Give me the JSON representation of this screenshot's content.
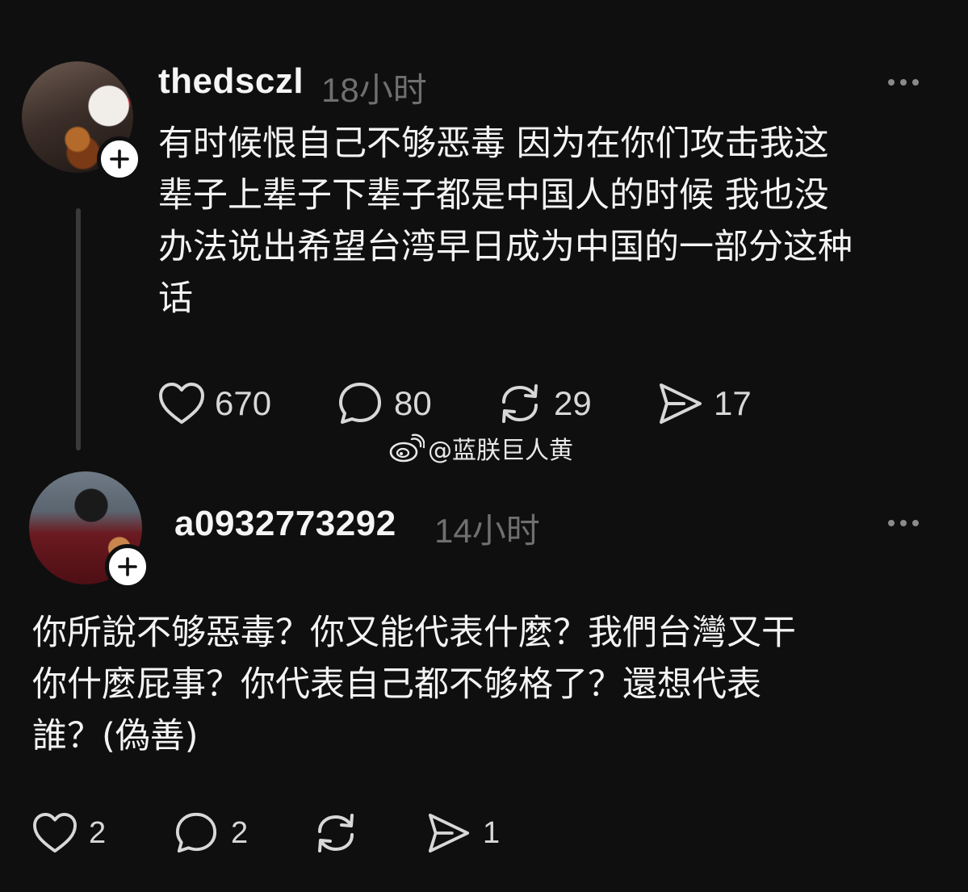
{
  "posts": [
    {
      "username": "thedsczl",
      "time": "18小时",
      "text_lines": [
        "有时候恨自己不够恶毒  因为在你们攻击我这",
        "辈子上辈子下辈子都是中国人的时候 我也没",
        "办法说出希望台湾早日成为中国的一部分这种",
        "话"
      ],
      "likes": "670",
      "comments": "80",
      "reposts": "29",
      "shares": "17"
    },
    {
      "username": "a0932773292",
      "time": "14小时",
      "text_lines": [
        "你所說不够惡毒？你又能代表什麼？我們台灣又干",
        "你什麼屁事？你代表自己都不够格了？還想代表",
        "誰？(偽善)"
      ],
      "likes": "2",
      "comments": "2",
      "reposts": "",
      "shares": "1"
    }
  ],
  "watermark": "@蓝朕巨人黄",
  "icons": {
    "avatar_badge": "plus-icon",
    "more": "more-dots-icon",
    "like": "heart-icon",
    "comment": "comment-bubble-icon",
    "repost": "repost-icon",
    "share": "send-icon",
    "watermark": "weibo-logo-icon"
  },
  "colors": {
    "background": "#0f0f0f",
    "text": "#f3f3f3",
    "muted": "#6f6f6f"
  }
}
